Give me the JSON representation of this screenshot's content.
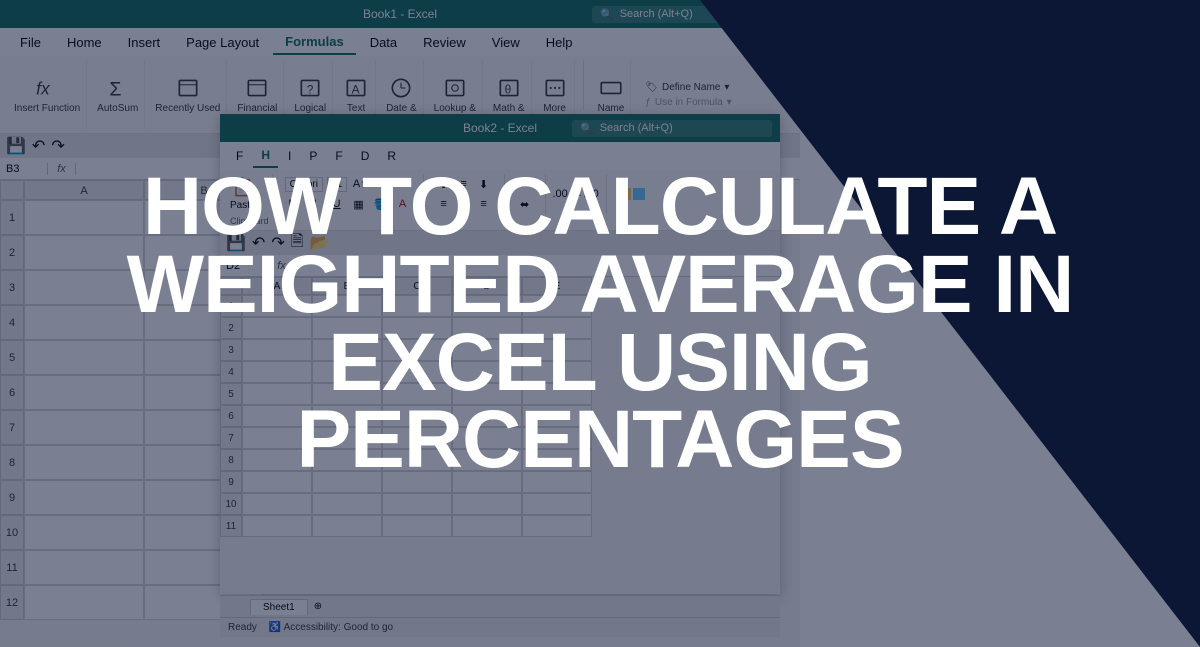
{
  "headline": "HOW TO CALCULATE A WEIGHTED AVERAGE IN EXCEL USING PERCENTAGES",
  "win1": {
    "title": "Book1 - Excel",
    "search_placeholder": "Search (Alt+Q)",
    "menus": [
      "File",
      "Home",
      "Insert",
      "Page Layout",
      "Formulas",
      "Data",
      "Review",
      "View",
      "Help"
    ],
    "active_menu": "Formulas",
    "ribbon_items": [
      "Insert Function",
      "AutoSum",
      "Recently Used",
      "Financial",
      "Logical",
      "Text",
      "Date &",
      "Lookup &",
      "Math &",
      "More"
    ],
    "name_group_label": "Name",
    "define_name": "Define Name",
    "use_in_formula": "Use in Formula",
    "namebox": "B3",
    "columns": [
      "A",
      "B"
    ],
    "rows": [
      1,
      2,
      3,
      4,
      5,
      6,
      7,
      8,
      9,
      10,
      11,
      12
    ]
  },
  "win2": {
    "title": "Book2 - Excel",
    "search_placeholder": "Search (Alt+Q)",
    "menus_visible": [
      "F",
      "H",
      "I",
      "P",
      "F",
      "D",
      "R"
    ],
    "paste_label": "Paste",
    "clipboard_label": "Clipboard",
    "font_name": "Calibri",
    "font_size": "11",
    "namebox": "D2",
    "columns": [
      "A",
      "B",
      "C",
      "D",
      "E"
    ],
    "rows": [
      1,
      2,
      3,
      4,
      5,
      6,
      7,
      8,
      9,
      10,
      11
    ],
    "sheet_tab": "Sheet1",
    "status_ready": "Ready",
    "status_accessibility": "Accessibility: Good to go"
  }
}
